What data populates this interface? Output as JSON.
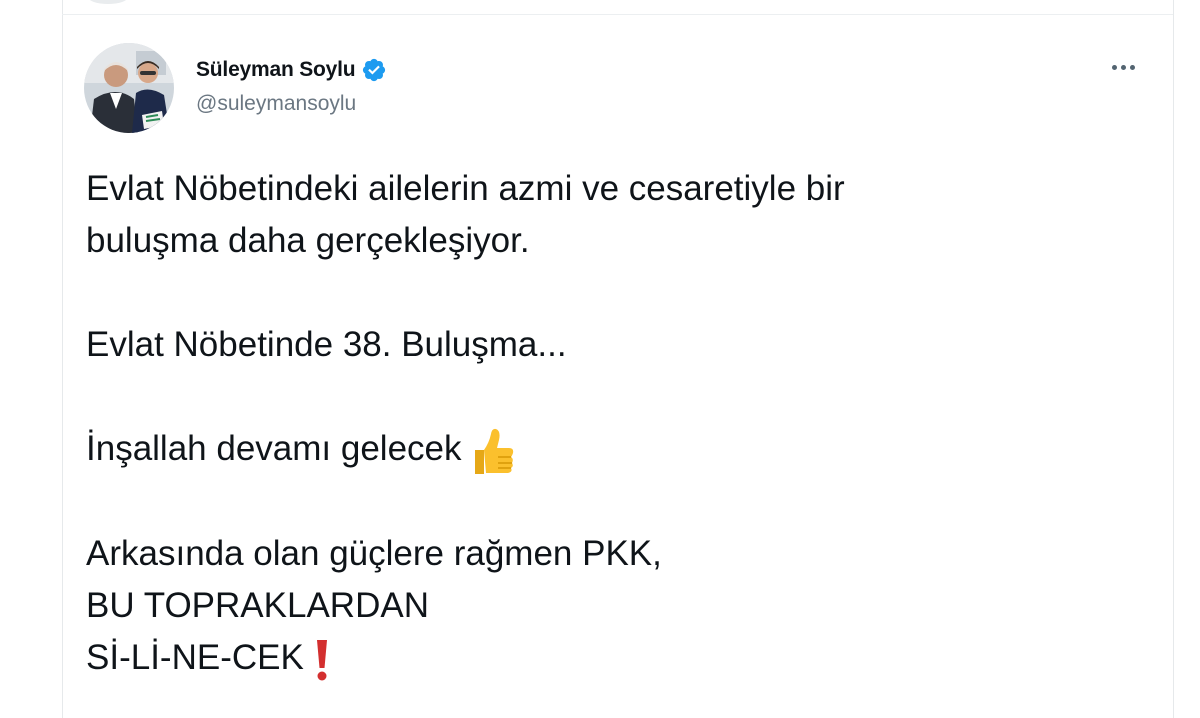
{
  "tweet": {
    "author": {
      "display_name": "Süleyman Soylu",
      "handle": "@suleymansoylu",
      "verified": true
    },
    "more_icon": "more-horizontal-icon",
    "lines": {
      "l1": "Evlat Nöbetindeki ailelerin azmi ve cesaretiyle bir",
      "l2": "buluşma daha gerçekleşiyor.",
      "l3": "Evlat Nöbetinde 38. Buluşma...",
      "l4": "İnşallah devamı gelecek",
      "l5": "Arkasında olan güçlere rağmen PKK,",
      "l6": "BU TOPRAKLARDAN",
      "l7": "Sİ-Lİ-NE-CEK"
    },
    "emojis": {
      "thumbs_up": "thumbs-up-emoji",
      "exclamation": "red-exclamation-emoji"
    },
    "colors": {
      "verified_blue": "#1d9bf0",
      "text": "#0f1419",
      "secondary": "#6b7782"
    }
  }
}
